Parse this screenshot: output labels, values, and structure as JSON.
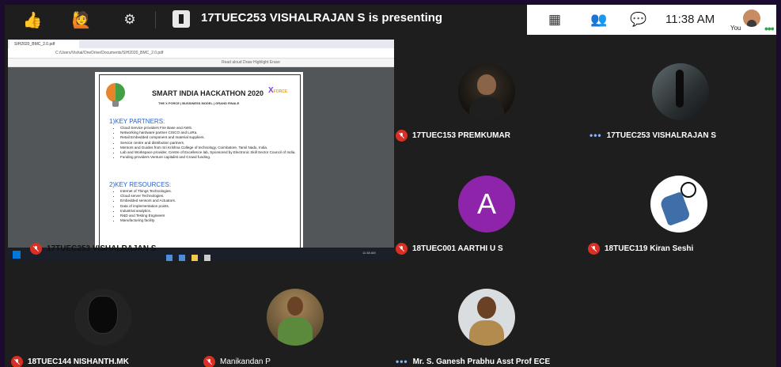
{
  "toolbar": {
    "raise_hand_icon": "thumbs-up-icon",
    "reactions_icon": "raise-hand-icon",
    "settings_icon": "gear-icon",
    "presenting_title": "17TUEC253 VISHALRAJAN S is presenting",
    "clock": "11:38 AM",
    "you_label": "You"
  },
  "screen_share": {
    "browser_tab": "SIH2020_BMC_2.0.pdf",
    "url": "C:/Users/Vishal/OneDrive/Documents/SIH2020_BMC_2.0.pdf",
    "toolbar_text": "Read aloud   Draw   Highlight   Erase",
    "doc_title": "SMART INDIA HACKATHON 2020",
    "doc_subtitle": "THE X FORCE | BUSSINESS MODEL | GRAND FINALE",
    "logo_text": "X",
    "logo_small": "FORCE",
    "section1_heading": "1)KEY PARTNERS:",
    "section1_items": [
      "Cloud Service providers Fire Base and AWS.",
      "Networking hardware partner CISCO and LoRa.",
      "Retail Embedded component and material suppliers.",
      "Service centre and distribution partners.",
      "Mentors and Guides from Sri Krishna College of technology, Coimbatore, Tamil Nadu, India.",
      "Lab and Workspace provider, Centre of Excellence lab, Sponsored by Electronic Skill Sector Council of India.",
      "Funding providers Venture capitalist and Crowd funding."
    ],
    "section2_heading": "2)KEY RESOURCES:",
    "section2_items": [
      "Internet of Things Technologies.",
      "Cloud server Technologies.",
      "Embedded sensors and Actuators.",
      "Data of implementation points.",
      "Industrial analytics.",
      "R&D and Testing Engineers",
      "Manufacturing facility."
    ],
    "taskbar_time": "11:38 AM",
    "presenter_name": "17TUEC253 VISHALRAJAN S"
  },
  "participants": [
    {
      "name": "17TUEC153 PREMKUMAR",
      "muted": true
    },
    {
      "name": "17TUEC253 VISHALRAJAN S",
      "muted": false,
      "speaking_dots": "•••"
    },
    {
      "name": "18TUEC001 AARTHI U S",
      "muted": true,
      "initial": "A"
    },
    {
      "name": "18TUEC119 Kiran Seshi",
      "muted": true
    },
    {
      "name": "18TUEC144 NISHANTH.MK",
      "muted": true
    },
    {
      "name": "Manikandan P",
      "muted": true
    },
    {
      "name": "Mr. S. Ganesh Prabhu Asst Prof ECE",
      "muted": false,
      "speaking_dots": "•••"
    }
  ],
  "colors": {
    "mic_off": "#d93025",
    "aarthi_avatar": "#8e24aa",
    "tile_bg": "#1e1e1e",
    "outer_bg": "#1b0b2e"
  }
}
